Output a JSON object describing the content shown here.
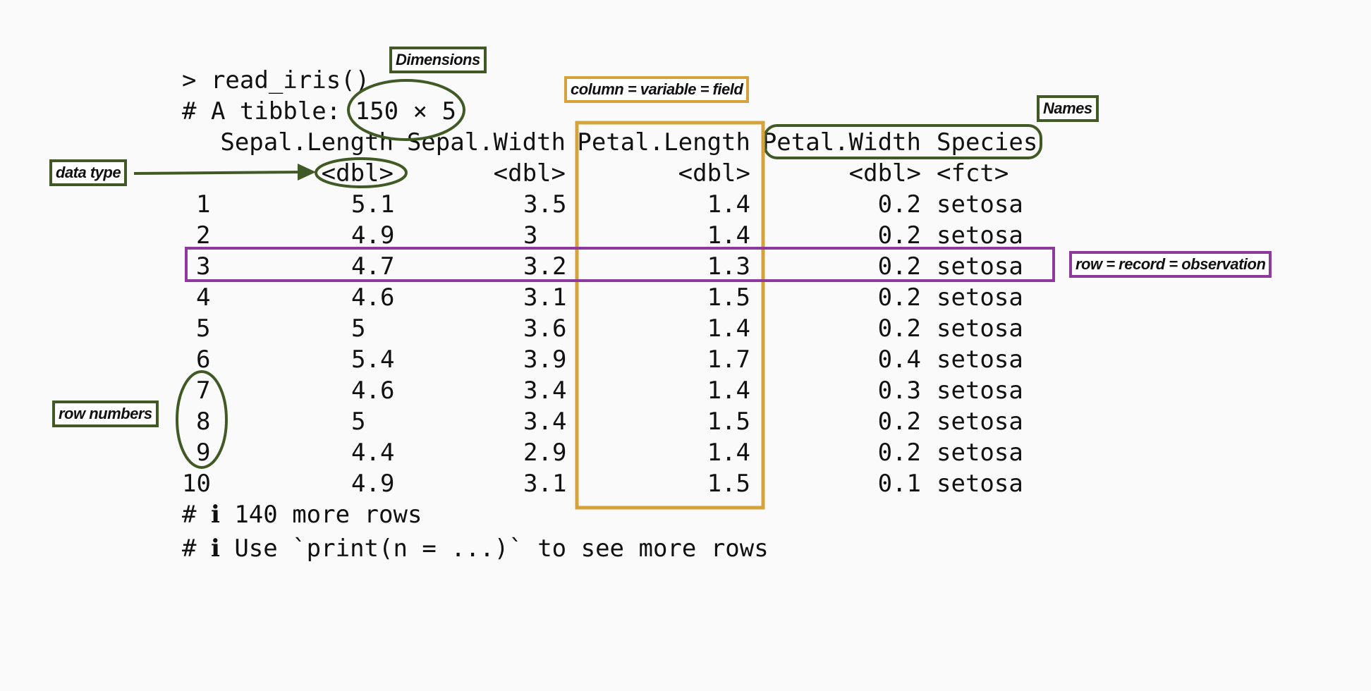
{
  "console": {
    "command": "> read_iris()",
    "tibble_prefix": "# A tibble: ",
    "dimensions": "150 × 5",
    "footer": [
      "# ℹ 140 more rows",
      "# ℹ Use `print(n = ...)` to see more rows"
    ]
  },
  "table": {
    "columns": [
      {
        "name": "Sepal.Length",
        "type": "<dbl>"
      },
      {
        "name": "Sepal.Width",
        "type": "<dbl>"
      },
      {
        "name": "Petal.Length",
        "type": "<dbl>"
      },
      {
        "name": "Petal.Width",
        "type": "<dbl>"
      },
      {
        "name": "Species",
        "type": "<fct>"
      }
    ],
    "rows": [
      [
        "1",
        "5.1",
        "3.5",
        "1.4",
        "0.2",
        "setosa"
      ],
      [
        "2",
        "4.9",
        "3",
        "1.4",
        "0.2",
        "setosa"
      ],
      [
        "3",
        "4.7",
        "3.2",
        "1.3",
        "0.2",
        "setosa"
      ],
      [
        "4",
        "4.6",
        "3.1",
        "1.5",
        "0.2",
        "setosa"
      ],
      [
        "5",
        "5",
        "3.6",
        "1.4",
        "0.2",
        "setosa"
      ],
      [
        "6",
        "5.4",
        "3.9",
        "1.7",
        "0.4",
        "setosa"
      ],
      [
        "7",
        "4.6",
        "3.4",
        "1.4",
        "0.3",
        "setosa"
      ],
      [
        "8",
        "5",
        "3.4",
        "1.5",
        "0.2",
        "setosa"
      ],
      [
        "9",
        "4.4",
        "2.9",
        "1.4",
        "0.2",
        "setosa"
      ],
      [
        "10",
        "4.9",
        "3.1",
        "1.5",
        "0.1",
        "setosa"
      ]
    ]
  },
  "annotations": {
    "dimensions": "Dimensions",
    "column": "column = variable = field",
    "names": "Names",
    "data_type": "data type",
    "row": "row = record = observation",
    "row_numbers": "row numbers"
  },
  "colors": {
    "green": "#415a25",
    "gold": "#d5a23b",
    "purple": "#8d3a9c"
  }
}
